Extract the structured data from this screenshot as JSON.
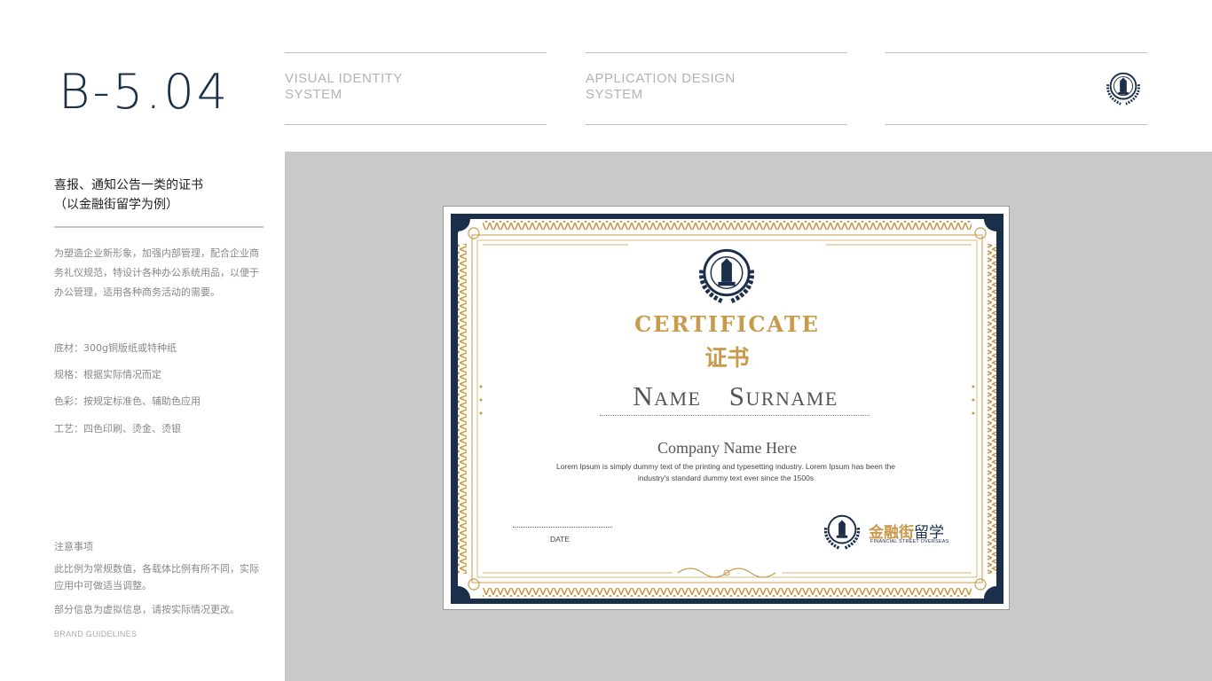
{
  "header": {
    "code": "B-5.04",
    "col1": {
      "line1": "VISUAL IDENTITY",
      "line2": "SYSTEM"
    },
    "col2": {
      "line1": "APPLICATION DESIGN",
      "line2": "SYSTEM"
    }
  },
  "left": {
    "title_line1": "喜报、通知公告一类的证书",
    "title_line2": "（以金融街留学为例）",
    "desc": "为塑造企业新形象，加强内部管理，配合企业商务礼仪规范，特设计各种办公系统用品，以便于办公管理，适用各种商务活动的需要。",
    "specs": [
      "底材：300g铜版纸或特种纸",
      "规格：根据实际情况而定",
      "色彩：按规定标准色、辅助色应用",
      "工艺：四色印刷、烫金、烫银"
    ],
    "notes_title": "注意事项",
    "notes": [
      "此比例为常规数值，各载体比例有所不同，实际应用中可做适当调整。",
      "部分信息为虚拟信息，请按实际情况更改。"
    ],
    "brand": "BRAND GUIDELINES"
  },
  "certificate": {
    "title": "CERTIFICATE",
    "subtitle": "证书",
    "name": "Name Surname",
    "company": "Company Name Here",
    "lorem": "Lorem Ipsum is simply dummy text of the printing and typesetting industry. Lorem Ipsum has been the industry's standard dummy text ever since the 1500s",
    "date_label": "DATE",
    "logo_cn_gold": "金融街",
    "logo_cn_navy": "留学",
    "logo_en": "FINANCIAL STREET OVERSEAS"
  },
  "colors": {
    "navy": "#1c2f4a",
    "gold": "#c99a4b",
    "panel_gray": "#c9c9c9"
  }
}
